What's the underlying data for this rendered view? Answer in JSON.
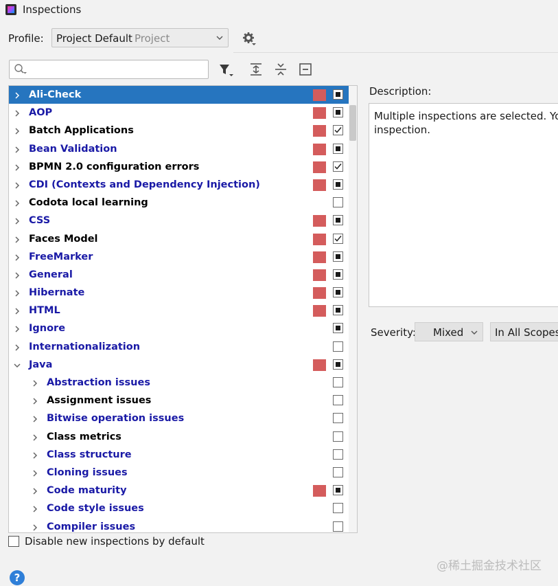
{
  "window": {
    "title": "Inspections"
  },
  "profile": {
    "label": "Profile:",
    "value": "Project Default",
    "scope": "Project"
  },
  "search": {
    "placeholder": "",
    "value": ""
  },
  "tree": {
    "rows": [
      {
        "label": "Ali-Check",
        "level": 0,
        "expanded": false,
        "selected": true,
        "color": "blue",
        "severity": true,
        "check": "mixed"
      },
      {
        "label": "AOP",
        "level": 0,
        "expanded": false,
        "color": "blue",
        "severity": true,
        "check": "mixed"
      },
      {
        "label": "Batch Applications",
        "level": 0,
        "expanded": false,
        "color": "black",
        "severity": true,
        "check": "checked"
      },
      {
        "label": "Bean Validation",
        "level": 0,
        "expanded": false,
        "color": "blue",
        "severity": true,
        "check": "mixed"
      },
      {
        "label": "BPMN 2.0 configuration errors",
        "level": 0,
        "expanded": false,
        "color": "black",
        "severity": true,
        "check": "checked"
      },
      {
        "label": "CDI (Contexts and Dependency Injection)",
        "level": 0,
        "expanded": false,
        "color": "blue",
        "severity": true,
        "check": "mixed"
      },
      {
        "label": "Codota local learning",
        "level": 0,
        "expanded": false,
        "color": "black",
        "severity": false,
        "check": "unchecked"
      },
      {
        "label": "CSS",
        "level": 0,
        "expanded": false,
        "color": "blue",
        "severity": true,
        "check": "mixed"
      },
      {
        "label": "Faces Model",
        "level": 0,
        "expanded": false,
        "color": "black",
        "severity": true,
        "check": "checked"
      },
      {
        "label": "FreeMarker",
        "level": 0,
        "expanded": false,
        "color": "blue",
        "severity": true,
        "check": "mixed"
      },
      {
        "label": "General",
        "level": 0,
        "expanded": false,
        "color": "blue",
        "severity": true,
        "check": "mixed"
      },
      {
        "label": "Hibernate",
        "level": 0,
        "expanded": false,
        "color": "blue",
        "severity": true,
        "check": "mixed"
      },
      {
        "label": "HTML",
        "level": 0,
        "expanded": false,
        "color": "blue",
        "severity": true,
        "check": "mixed"
      },
      {
        "label": "Ignore",
        "level": 0,
        "expanded": false,
        "color": "blue",
        "severity": false,
        "check": "mixed"
      },
      {
        "label": "Internationalization",
        "level": 0,
        "expanded": false,
        "color": "blue",
        "severity": false,
        "check": "unchecked"
      },
      {
        "label": "Java",
        "level": 0,
        "expanded": true,
        "color": "blue",
        "severity": true,
        "check": "mixed"
      },
      {
        "label": "Abstraction issues",
        "level": 1,
        "expanded": false,
        "color": "blue",
        "severity": false,
        "check": "unchecked"
      },
      {
        "label": "Assignment issues",
        "level": 1,
        "expanded": false,
        "color": "black",
        "severity": false,
        "check": "unchecked"
      },
      {
        "label": "Bitwise operation issues",
        "level": 1,
        "expanded": false,
        "color": "blue",
        "severity": false,
        "check": "unchecked"
      },
      {
        "label": "Class metrics",
        "level": 1,
        "expanded": false,
        "color": "black",
        "severity": false,
        "check": "unchecked"
      },
      {
        "label": "Class structure",
        "level": 1,
        "expanded": false,
        "color": "blue",
        "severity": false,
        "check": "unchecked"
      },
      {
        "label": "Cloning issues",
        "level": 1,
        "expanded": false,
        "color": "blue",
        "severity": false,
        "check": "unchecked"
      },
      {
        "label": "Code maturity",
        "level": 1,
        "expanded": false,
        "color": "blue",
        "severity": true,
        "check": "mixed"
      },
      {
        "label": "Code style issues",
        "level": 1,
        "expanded": false,
        "color": "blue",
        "severity": false,
        "check": "unchecked"
      },
      {
        "label": "Compiler issues",
        "level": 1,
        "expanded": false,
        "color": "blue",
        "severity": false,
        "check": "unchecked"
      }
    ]
  },
  "footer": {
    "disable_label": "Disable new inspections by default",
    "help": "?"
  },
  "watermark": "@稀土掘金技术社区",
  "description": {
    "label": "Description:",
    "line1": "Multiple inspections are selected. You",
    "line2": "inspection."
  },
  "severity": {
    "label": "Severity:",
    "value": "Mixed",
    "scope": "In All Scopes"
  },
  "colors": {
    "selection": "#2675bf",
    "severity_marker": "#d45c5c",
    "blue_text": "#1a1aa6"
  }
}
